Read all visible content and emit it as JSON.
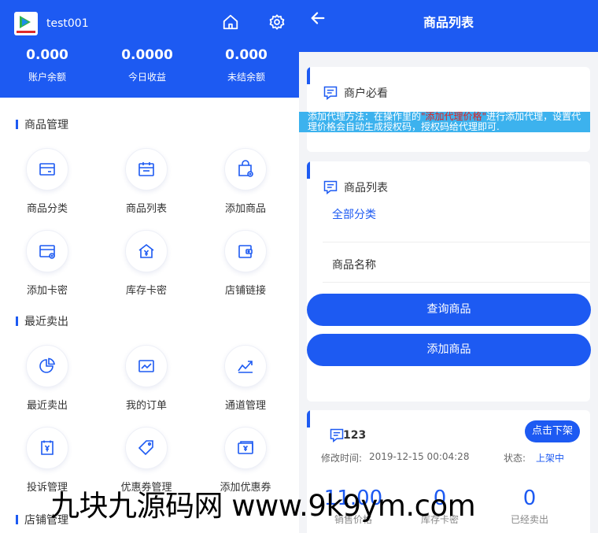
{
  "left": {
    "username": "test001",
    "stats": [
      {
        "value": "0.000",
        "label": "账户余额"
      },
      {
        "value": "0.0000",
        "label": "今日收益"
      },
      {
        "value": "0.000",
        "label": "未结余额"
      }
    ],
    "sections": [
      {
        "title": "商品管理",
        "items": [
          {
            "label": "商品分类",
            "icon": "category-icon"
          },
          {
            "label": "商品列表",
            "icon": "calendar-list-icon"
          },
          {
            "label": "添加商品",
            "icon": "bag-add-icon"
          },
          {
            "label": "添加卡密",
            "icon": "card-add-icon"
          },
          {
            "label": "库存卡密",
            "icon": "house-yen-icon"
          },
          {
            "label": "店铺链接",
            "icon": "wallet-link-icon"
          }
        ]
      },
      {
        "title": "最近卖出",
        "items": [
          {
            "label": "最近卖出",
            "icon": "pie-chart-icon"
          },
          {
            "label": "我的订单",
            "icon": "line-chart-icon"
          },
          {
            "label": "通道管理",
            "icon": "trend-icon"
          },
          {
            "label": "投诉管理",
            "icon": "yen-doc-icon"
          },
          {
            "label": "优惠券管理",
            "icon": "tag-icon"
          },
          {
            "label": "添加优惠券",
            "icon": "yen-card-icon"
          }
        ]
      },
      {
        "title": "店铺管理",
        "items": []
      }
    ]
  },
  "right": {
    "title": "商品列表",
    "notice_card": {
      "title": "商户必看",
      "text_a": "添加代理方法：在操作里的",
      "text_red": "\"添加代理价格\"",
      "text_b": "进行添加代理，设置代",
      "text_c": "理价格会自动生成授权码，授权码给代理即可."
    },
    "list_card": {
      "title": "商品列表",
      "category_filter": "全部分类",
      "name_filter": "商品名称",
      "query_button": "查询商品",
      "add_button": "添加商品"
    },
    "product": {
      "name": "123",
      "off_button": "点击下架",
      "modified_label": "修改时间:",
      "modified_time": "2019-12-15 00:04:28",
      "status_label": "状态:",
      "status_value": "上架中",
      "metrics": [
        {
          "value": "11.00",
          "label": "销售价格"
        },
        {
          "value": "0",
          "label": "库存卡密"
        },
        {
          "value": "0",
          "label": "已经卖出"
        }
      ]
    }
  },
  "watermark": "九块九源码网 www.9k9ym.com",
  "colors": {
    "primary": "#1d5af2",
    "notice_bg": "#3cb2ee",
    "notice_red": "#e11f1f"
  }
}
